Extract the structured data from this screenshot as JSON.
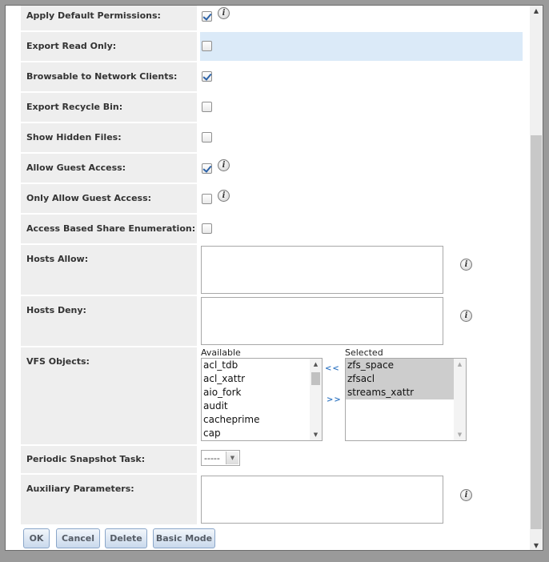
{
  "form": {
    "apply_default_permissions": {
      "label": "Apply Default Permissions:",
      "checked": true
    },
    "export_read_only": {
      "label": "Export Read Only:",
      "checked": false
    },
    "browsable": {
      "label": "Browsable to Network Clients:",
      "checked": true
    },
    "export_recycle_bin": {
      "label": "Export Recycle Bin:",
      "checked": false
    },
    "show_hidden_files": {
      "label": "Show Hidden Files:",
      "checked": false
    },
    "allow_guest_access": {
      "label": "Allow Guest Access:",
      "checked": true
    },
    "only_allow_guest_access": {
      "label": "Only Allow Guest Access:",
      "checked": false
    },
    "access_based_enum": {
      "label": "Access Based Share Enumeration:",
      "checked": false
    },
    "hosts_allow": {
      "label": "Hosts Allow:",
      "value": ""
    },
    "hosts_deny": {
      "label": "Hosts Deny:",
      "value": ""
    },
    "vfs_objects": {
      "label": "VFS Objects:",
      "available_caption": "Available",
      "selected_caption": "Selected",
      "available": [
        "acl_tdb",
        "acl_xattr",
        "aio_fork",
        "audit",
        "cacheprime",
        "cap"
      ],
      "selected": [
        "zfs_space",
        "zfsacl",
        "streams_xattr"
      ],
      "move_left": "<<",
      "move_right": ">>"
    },
    "periodic_snapshot": {
      "label": "Periodic Snapshot Task:",
      "value": "-----"
    },
    "auxiliary_parameters": {
      "label": "Auxiliary Parameters:",
      "value": ""
    }
  },
  "info_icon_glyph": "i",
  "buttons": {
    "ok": "OK",
    "cancel": "Cancel",
    "delete": "Delete",
    "basic_mode": "Basic Mode"
  },
  "colors": {
    "accent": "#2c62a8",
    "row_highlight": "#dbeaf8",
    "label_bg": "#eeeeee"
  }
}
